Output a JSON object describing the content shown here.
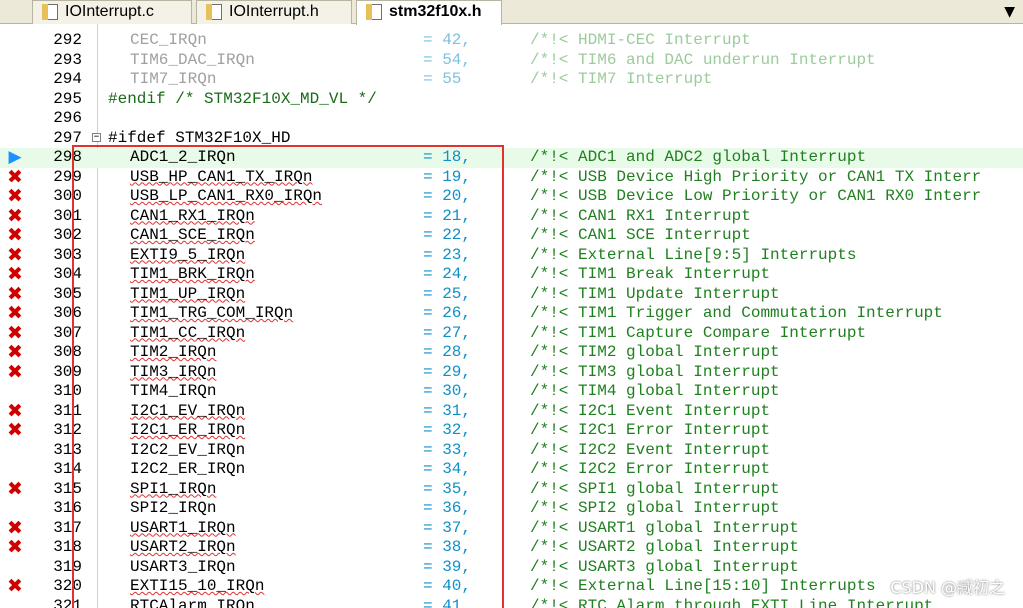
{
  "tabs": [
    {
      "label": "IOInterrupt.c",
      "active": false
    },
    {
      "label": "IOInterrupt.h",
      "active": false
    },
    {
      "label": "stm32f10x.h",
      "active": true
    }
  ],
  "tab_scroll_glyph": "▼",
  "fold_glyph": "−",
  "lines": [
    {
      "num": "292",
      "kind": "enum",
      "name": "CEC_IRQn",
      "eq": "= 42,",
      "comment": "/*!< HDMI-CEC Interrupt",
      "dim": true
    },
    {
      "num": "293",
      "kind": "enum",
      "name": "TIM6_DAC_IRQn",
      "eq": "= 54,",
      "comment": "/*!< TIM6 and DAC underrun Interrupt",
      "dim": true
    },
    {
      "num": "294",
      "kind": "enum",
      "name": "TIM7_IRQn",
      "eq": "= 55",
      "comment": "/*!< TIM7 Interrupt",
      "dim": true
    },
    {
      "num": "295",
      "kind": "pp",
      "text": "#endif /* STM32F10X_MD_VL */"
    },
    {
      "num": "296",
      "kind": "blank"
    },
    {
      "num": "297",
      "kind": "ppkw",
      "text": "#ifdef STM32F10X_HD",
      "fold": true
    },
    {
      "num": "298",
      "kind": "enum",
      "name": "ADC1_2_IRQn",
      "eq": "= 18,",
      "comment": "/*!< ADC1 and ADC2 global Interrupt",
      "mark": "arrow",
      "current": true
    },
    {
      "num": "299",
      "kind": "enum",
      "name": "USB_HP_CAN1_TX_IRQn",
      "eq": "= 19,",
      "comment": "/*!< USB Device High Priority or CAN1 TX Interr",
      "mark": "x",
      "err": true
    },
    {
      "num": "300",
      "kind": "enum",
      "name": "USB_LP_CAN1_RX0_IRQn",
      "eq": "= 20,",
      "comment": "/*!< USB Device Low Priority or CAN1 RX0 Interr",
      "mark": "x",
      "err": true
    },
    {
      "num": "301",
      "kind": "enum",
      "name": "CAN1_RX1_IRQn",
      "eq": "= 21,",
      "comment": "/*!< CAN1 RX1 Interrupt",
      "mark": "x",
      "err": true
    },
    {
      "num": "302",
      "kind": "enum",
      "name": "CAN1_SCE_IRQn",
      "eq": "= 22,",
      "comment": "/*!< CAN1 SCE Interrupt",
      "mark": "x",
      "err": true
    },
    {
      "num": "303",
      "kind": "enum",
      "name": "EXTI9_5_IRQn",
      "eq": "= 23,",
      "comment": "/*!< External Line[9:5] Interrupts",
      "mark": "x",
      "err": true
    },
    {
      "num": "304",
      "kind": "enum",
      "name": "TIM1_BRK_IRQn",
      "eq": "= 24,",
      "comment": "/*!< TIM1 Break Interrupt",
      "mark": "x",
      "err": true
    },
    {
      "num": "305",
      "kind": "enum",
      "name": "TIM1_UP_IRQn",
      "eq": "= 25,",
      "comment": "/*!< TIM1 Update Interrupt",
      "mark": "x",
      "err": true
    },
    {
      "num": "306",
      "kind": "enum",
      "name": "TIM1_TRG_COM_IRQn",
      "eq": "= 26,",
      "comment": "/*!< TIM1 Trigger and Commutation Interrupt",
      "mark": "x",
      "err": true
    },
    {
      "num": "307",
      "kind": "enum",
      "name": "TIM1_CC_IRQn",
      "eq": "= 27,",
      "comment": "/*!< TIM1 Capture Compare Interrupt",
      "mark": "x",
      "err": true
    },
    {
      "num": "308",
      "kind": "enum",
      "name": "TIM2_IRQn",
      "eq": "= 28,",
      "comment": "/*!< TIM2 global Interrupt",
      "mark": "x",
      "err": true
    },
    {
      "num": "309",
      "kind": "enum",
      "name": "TIM3_IRQn",
      "eq": "= 29,",
      "comment": "/*!< TIM3 global Interrupt",
      "mark": "x",
      "err": true
    },
    {
      "num": "310",
      "kind": "enum",
      "name": "TIM4_IRQn",
      "eq": "= 30,",
      "comment": "/*!< TIM4 global Interrupt"
    },
    {
      "num": "311",
      "kind": "enum",
      "name": "I2C1_EV_IRQn",
      "eq": "= 31,",
      "comment": "/*!< I2C1 Event Interrupt",
      "mark": "x",
      "err": true
    },
    {
      "num": "312",
      "kind": "enum",
      "name": "I2C1_ER_IRQn",
      "eq": "= 32,",
      "comment": "/*!< I2C1 Error Interrupt",
      "mark": "x",
      "err": true
    },
    {
      "num": "313",
      "kind": "enum",
      "name": "I2C2_EV_IRQn",
      "eq": "= 33,",
      "comment": "/*!< I2C2 Event Interrupt"
    },
    {
      "num": "314",
      "kind": "enum",
      "name": "I2C2_ER_IRQn",
      "eq": "= 34,",
      "comment": "/*!< I2C2 Error Interrupt"
    },
    {
      "num": "315",
      "kind": "enum",
      "name": "SPI1_IRQn",
      "eq": "= 35,",
      "comment": "/*!< SPI1 global Interrupt",
      "mark": "x",
      "err": true
    },
    {
      "num": "316",
      "kind": "enum",
      "name": "SPI2_IRQn",
      "eq": "= 36,",
      "comment": "/*!< SPI2 global Interrupt"
    },
    {
      "num": "317",
      "kind": "enum",
      "name": "USART1_IRQn",
      "eq": "= 37,",
      "comment": "/*!< USART1 global Interrupt",
      "mark": "x",
      "err": true
    },
    {
      "num": "318",
      "kind": "enum",
      "name": "USART2_IRQn",
      "eq": "= 38,",
      "comment": "/*!< USART2 global Interrupt",
      "mark": "x",
      "err": true
    },
    {
      "num": "319",
      "kind": "enum",
      "name": "USART3_IRQn",
      "eq": "= 39,",
      "comment": "/*!< USART3 global Interrupt"
    },
    {
      "num": "320",
      "kind": "enum",
      "name": "EXTI15_10_IRQn",
      "eq": "= 40,",
      "comment": "/*!< External Line[15:10] Interrupts",
      "mark": "x",
      "err": true
    },
    {
      "num": "321",
      "kind": "enum",
      "name": "RTCAlarm_IRQn",
      "eq": "= 41,",
      "comment": "/*!< RTC Alarm through EXTI Line Interrupt"
    }
  ],
  "watermark": "CSDN @臧初之",
  "colors": {
    "error_mark": "#d00000",
    "current_line_arrow": "#1e90ff",
    "current_line_bg": "#e8fbe8",
    "highlight_box": "#e53030",
    "comment": "#208020",
    "operator": "#1090c8"
  }
}
